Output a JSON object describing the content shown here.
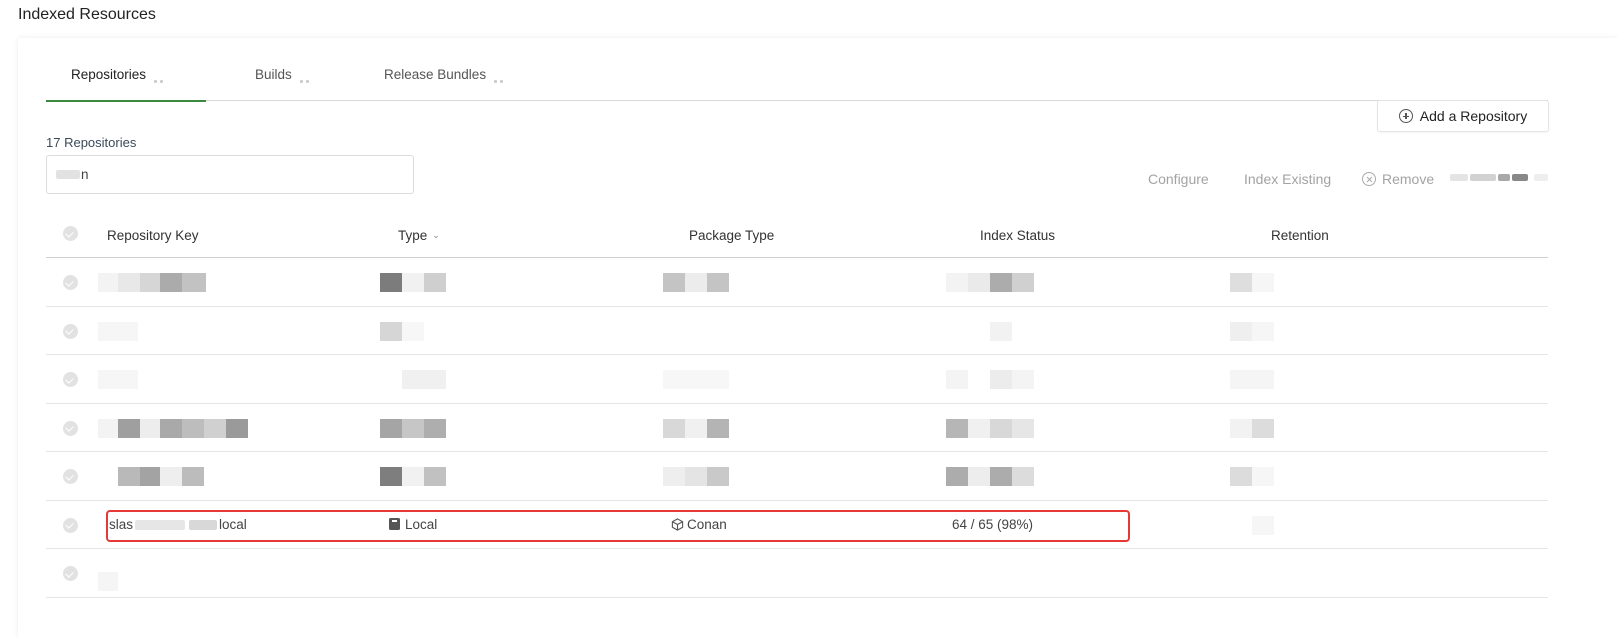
{
  "page": {
    "title": "Indexed Resources"
  },
  "tabs": [
    {
      "label": "Repositories",
      "active": true
    },
    {
      "label": "Builds",
      "active": false
    },
    {
      "label": "Release Bundles",
      "active": false
    }
  ],
  "toolbar": {
    "add_repository": "Add a Repository",
    "repo_count": "17 Repositories",
    "search_value": "n",
    "configure": "Configure",
    "index_existing": "Index Existing",
    "remove": "Remove"
  },
  "table": {
    "headers": {
      "repository_key": "Repository Key",
      "type": "Type",
      "package_type": "Package Type",
      "index_status": "Index Status",
      "retention": "Retention"
    },
    "highlighted_row": {
      "repository_key_start": "slas",
      "repository_key_end": "local",
      "type": "Local",
      "package_type": "Conan",
      "index_status": "64 / 65 (98%)"
    }
  },
  "colors": {
    "accent": "#3b8a3e",
    "highlight_border": "#e53935",
    "disabled_text": "#a3a3a3"
  },
  "icons": {
    "add": "plus-circle-icon",
    "remove": "x-circle-icon",
    "type_local": "local-repo-icon",
    "package_conan": "cube-icon",
    "row_select": "check-circle-icon"
  }
}
